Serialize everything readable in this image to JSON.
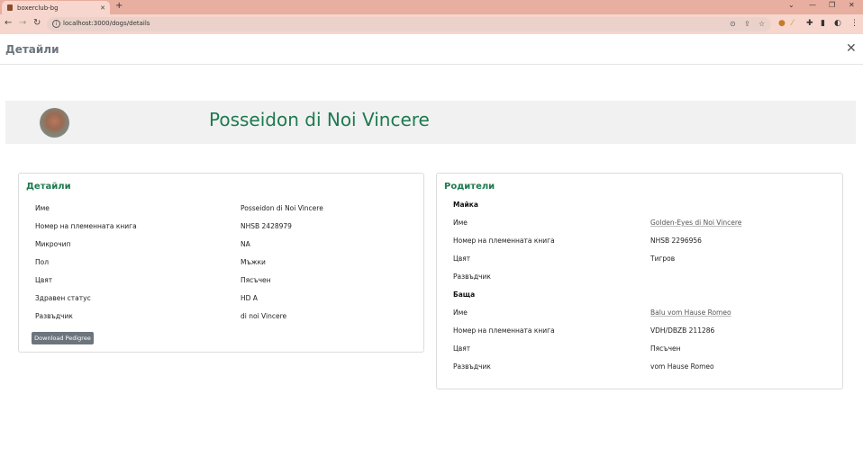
{
  "browser": {
    "tab_title": "boxerclub-bg",
    "tab_close": "✕",
    "new_tab": "+",
    "url": "localhost:3000/dogs/details",
    "win_min": "⌄",
    "win_minimize": "—",
    "win_restore": "❐",
    "win_close": "✕"
  },
  "modal": {
    "title": "Детайли",
    "close": "✕"
  },
  "hero": {
    "dog_name": "Posseidon di Noi Vincere"
  },
  "details_card": {
    "title": "Детайли",
    "rows": [
      {
        "label": "Име",
        "value": "Posseidon di Noi Vincere"
      },
      {
        "label": "Номер на племенната книга",
        "value": "NHSB 2428979"
      },
      {
        "label": "Микрочип",
        "value": "NA"
      },
      {
        "label": "Пол",
        "value": "Мъжки"
      },
      {
        "label": "Цвят",
        "value": "Пясъчен"
      },
      {
        "label": "Здравен статус",
        "value": "HD A"
      },
      {
        "label": "Развъдчик",
        "value": "di noi Vincere"
      }
    ],
    "button": "Download Pedigree"
  },
  "parents_card": {
    "title": "Родители",
    "mother": {
      "heading": "Майка",
      "rows": [
        {
          "label": "Име",
          "value": "Golden-Eyes di Noi Vincere"
        },
        {
          "label": "Номер на племенната книга",
          "value": "NHSB 2296956"
        },
        {
          "label": "Цвят",
          "value": "Тигров"
        },
        {
          "label": "Развъдчик",
          "value": ""
        }
      ]
    },
    "father": {
      "heading": "Баща",
      "rows": [
        {
          "label": "Име",
          "value": "Balu vom Hause Romeo"
        },
        {
          "label": "Номер на племенната книга",
          "value": "VDH/DBZB 211286"
        },
        {
          "label": "Цвят",
          "value": "Пясъчен"
        },
        {
          "label": "Развъдчик",
          "value": "vom Hause Romeo"
        }
      ]
    }
  },
  "colors": {
    "accent_green": "#1e7a50",
    "button_gray": "#6c757d",
    "chrome_tabbar": "#e8aea0"
  }
}
